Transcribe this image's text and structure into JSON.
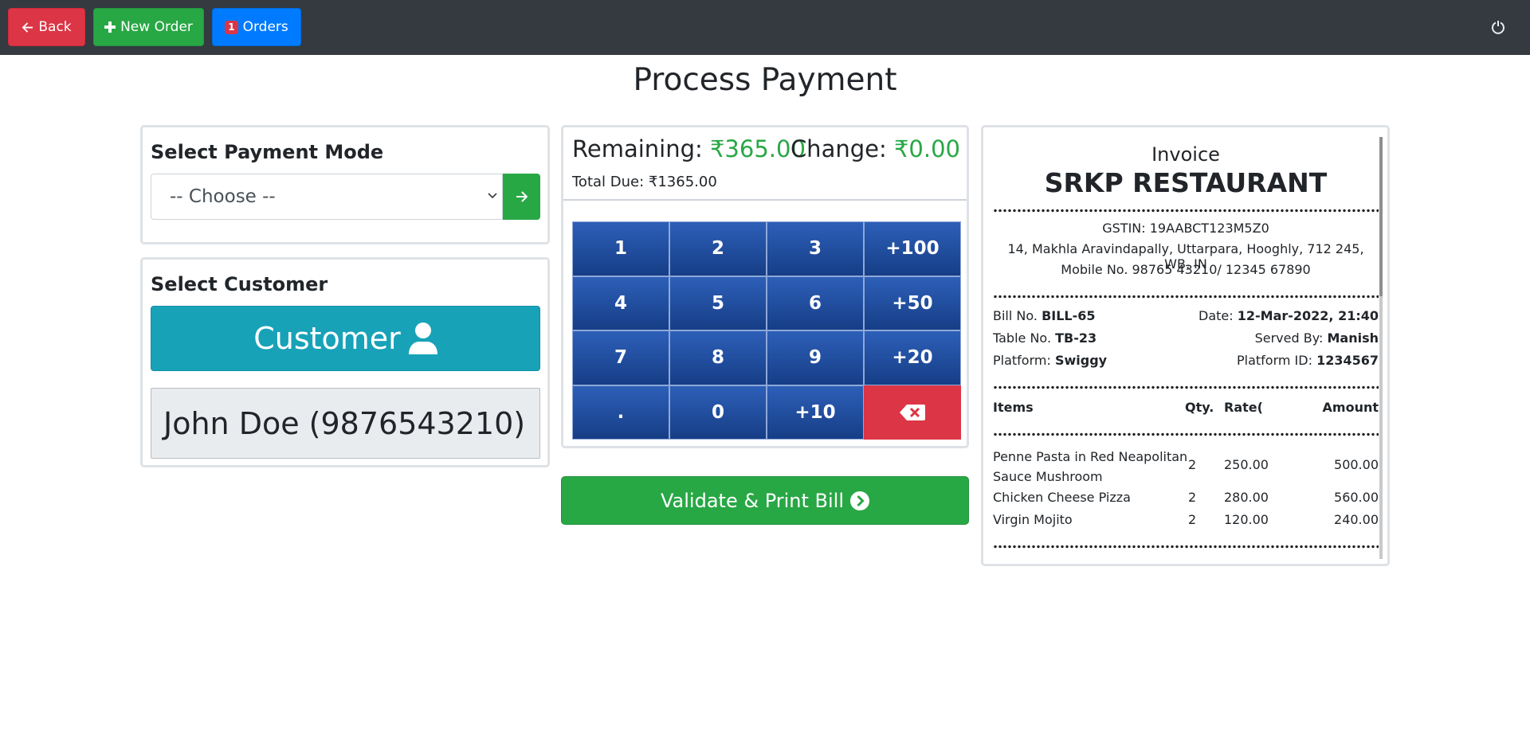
{
  "navbar": {
    "back_label": "Back",
    "new_order_label": "New Order",
    "orders_label": "Orders",
    "orders_count": "1"
  },
  "page_title": "Process Payment",
  "payment_mode": {
    "title": "Select Payment Mode",
    "selected": "-- Choose --"
  },
  "customer": {
    "title": "Select Customer",
    "button_label": "Customer",
    "selected": "John Doe (9876543210)"
  },
  "payment": {
    "remaining_label": "Remaining:",
    "remaining_value": "₹365.00",
    "change_label": "Change:",
    "change_value": "₹0.00",
    "total_due": "Total Due: ₹1365.00",
    "keys": [
      "1",
      "2",
      "3",
      "+100",
      "4",
      "5",
      "6",
      "+50",
      "7",
      "8",
      "9",
      "+20",
      ".",
      "0",
      "+10",
      ""
    ],
    "validate_label": "Validate & Print Bill"
  },
  "invoice": {
    "heading": "Invoice",
    "restaurant": "SRKP RESTAURANT",
    "gstin": "GSTIN: 19AABCT123M5Z0",
    "address": "14, Makhla Aravindapally, Uttarpara, Hooghly, 712 245, WB, IN",
    "mobile": "Mobile No. 98765 43210/ 12345 67890",
    "bill_no_label": "Bill No.",
    "bill_no": "BILL-65",
    "date_label": "Date:",
    "date": "12-Mar-2022, 21:40",
    "table_label": "Table No.",
    "table": "TB-23",
    "served_label": "Served By:",
    "served_by": "Manish",
    "platform_label": "Platform:",
    "platform": "Swiggy",
    "platform_id_label": "Platform ID:",
    "platform_id": "1234567",
    "columns": [
      "Items",
      "Qty.",
      "Rate(₹",
      "Amount"
    ],
    "items": [
      {
        "name_line1": "Penne Pasta in Red Neapolitan",
        "name_line2": "Sauce Mushroom",
        "qty": "2",
        "rate": "250.00",
        "amount": "500.00"
      },
      {
        "name_line1": "Chicken Cheese Pizza",
        "name_line2": "",
        "qty": "2",
        "rate": "280.00",
        "amount": "560.00"
      },
      {
        "name_line1": "Virgin Mojito",
        "name_line2": "",
        "qty": "2",
        "rate": "120.00",
        "amount": "240.00"
      }
    ]
  },
  "colors": {
    "navbar": "#343a40",
    "danger": "#dc3545",
    "success": "#28a745",
    "primary": "#007bff",
    "info": "#17a2b8",
    "keypad": "#1f4c9c"
  }
}
